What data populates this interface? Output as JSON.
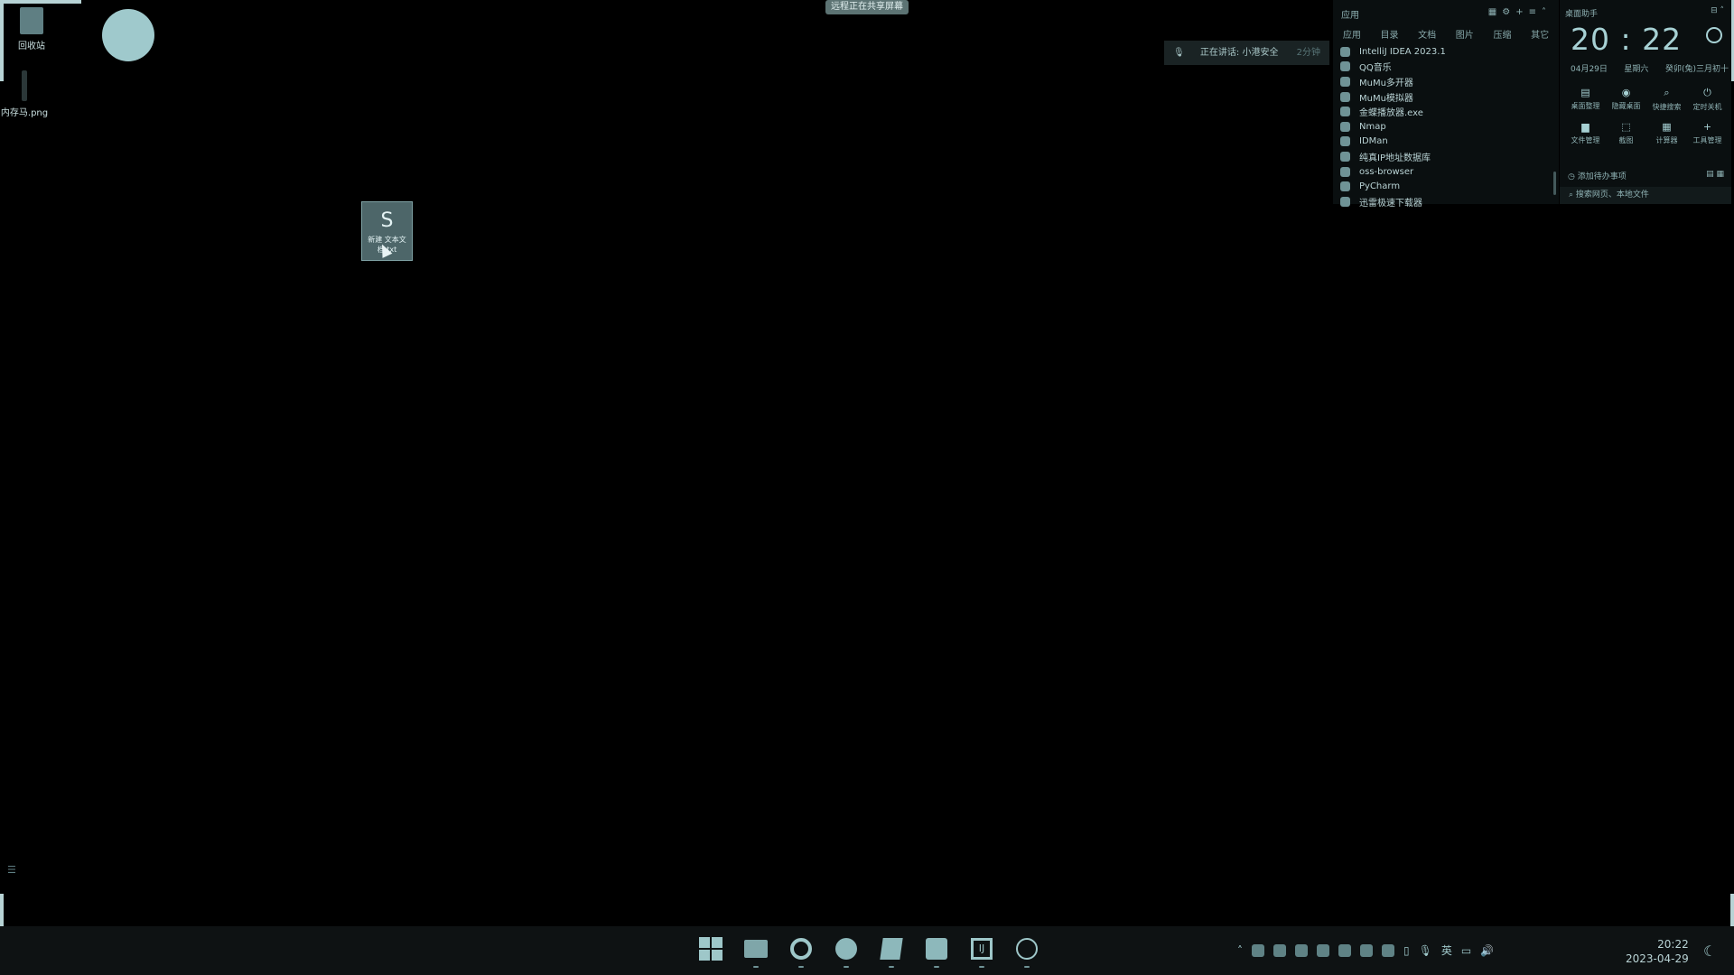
{
  "top_badge": "远程正在共享屏幕",
  "notice": {
    "text": "正在讲话: 小港安全",
    "extra": "2分钟"
  },
  "desktop": {
    "recycle_bin": "回收站",
    "png_file": "内存马.png",
    "txt_file": "新建 文本文档.txt"
  },
  "app_panel": {
    "title": "应用",
    "tabs": [
      "应用",
      "目录",
      "文档",
      "图片",
      "压缩",
      "其它"
    ],
    "apps": [
      "IntelliJ IDEA 2023.1",
      "QQ音乐",
      "MuMu多开器",
      "MuMu模拟器",
      "金蝶播放器.exe",
      "Nmap",
      "IDMan",
      "纯真IP地址数据库",
      "oss-browser",
      "PyCharm",
      "迅雷极速下载器"
    ]
  },
  "widget": {
    "title": "桌面助手",
    "hour": "20",
    "minute": "22",
    "date": "04月29日",
    "weekday": "星期六",
    "lunar": "癸卯(兔)三月初十",
    "quick": [
      {
        "icon": "▤",
        "label": "桌面整理"
      },
      {
        "icon": "◉",
        "label": "隐藏桌面"
      },
      {
        "icon": "⌕",
        "label": "快捷搜索"
      },
      {
        "icon": "⏻",
        "label": "定时关机"
      },
      {
        "icon": "▆",
        "label": "文件管理"
      },
      {
        "icon": "⬚",
        "label": "截图"
      },
      {
        "icon": "▦",
        "label": "计算器"
      },
      {
        "icon": "+",
        "label": "工具管理"
      }
    ],
    "reminder": "添加待办事项",
    "footer": "搜索网页、本地文件"
  },
  "taskbar": {
    "input_lang": "英",
    "time": "20:22",
    "date": "2023-04-29"
  },
  "colors": {
    "accent": "#a7d1d4",
    "taskbar": "#0e1213"
  }
}
